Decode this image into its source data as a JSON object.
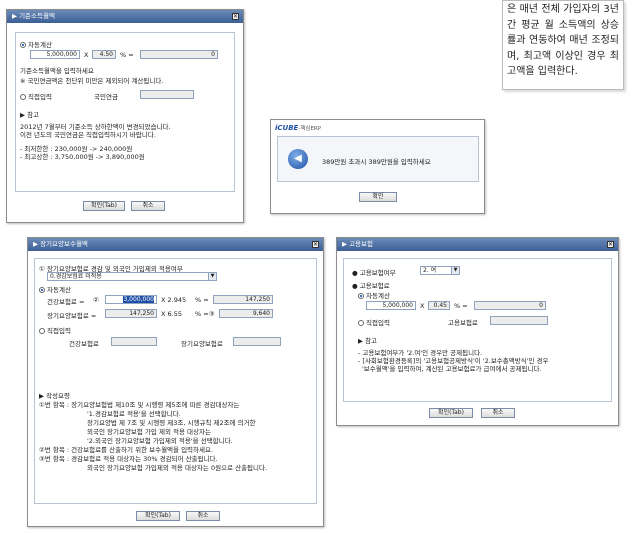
{
  "note": {
    "text": "은 매년 전체 가입자의 3년간 평균 월 소득액의 상승률과 연동하여 매년 조정되며, 최고액 이상인 경우 최고액을 입력한다."
  },
  "d1": {
    "title": "▶ 기준소득월액",
    "auto": "자동계산",
    "amount": "5,000,000",
    "x": "X",
    "rate": "4.50",
    "pct": "% =",
    "result": "0",
    "hint1": "기준소득월액을 입력하세요",
    "hint2": "※ 국민연금액은 천단위 미만은 제외되어 계산됩니다.",
    "manual": "직접입력",
    "pension_label": "국민연금",
    "ref": "▶ 참고",
    "ref1": "2012년 7월부터 기준소득 상하한액이 변경되었습니다.",
    "ref2": "이전 년도의 국민연금은 직접입력하시기 바랍니다.",
    "min": "- 최저한한 : 230,000원 -> 240,000원",
    "max": "- 최고상한 : 3,750,000원 -> 3,890,000원",
    "ok": "확인(Tab)",
    "cancel": "취소"
  },
  "d2": {
    "title_brand": "iCUBE",
    "title_rest": "-핵심ERP",
    "message": "389만원 초과시 389만원을 입력하세요",
    "ok": "확인"
  },
  "d3": {
    "title": "▶ 장기요양보수월액",
    "q": "① 장기요양보험료 경감 및 외국인 가입제외 적용여부",
    "select": "0.경감보험료 미적용",
    "auto": "자동계산",
    "health_label": "건강보험료 =",
    "circle2": "②",
    "health_value": "3,000,000",
    "x1": "X 2.945",
    "pct1": "% =",
    "r1": "147,250",
    "lt_label": "장기요양보험료 =",
    "lt_value": "147,250",
    "x2": "X 6.55",
    "pct2": "% =③",
    "r2": "9,640",
    "manual": "직접입력",
    "m_health": "건강보험료",
    "m_lt": "장기요양보험료",
    "guide": "▶ 작성요령",
    "g1": "①번 항목 : 장기요양보험법 제10조 및 시행령 제5조에 따른 경감대상자는",
    "g2": "'1.경감보험료 적용'을 선택합니다.",
    "g3": "장기요양법 제 7조 및 시행령 제3조, 시행규칙 제2조에 의거한",
    "g4": "외국인 장기요양보험 가입 제외 적용 대상자는",
    "g5": "'2.외국인 장기요양보험 가입제외 적용'을 선택합니다.",
    "g6": "②번 항목 : 건강보험료를 산출하기 위한 보수월액을 입력하세요.",
    "g7": "③번 항목 : 경감보험료 적용 대상자는 30% 경감되어 산출됩니다.",
    "g8": "외국인 장기요양보험 가입제외 적용 대상자는 0원으로 산출됩니다.",
    "ok": "확인(Tab)",
    "cancel": "취소"
  },
  "d4": {
    "title": "▶ 고용보험",
    "yn_label": "고용보험여부",
    "yn_value": "2. 여",
    "premium": "고용보험료",
    "auto": "자동계산",
    "amount": "5,000,000",
    "x": "X",
    "rate": "0.45",
    "pct": "% =",
    "result": "0",
    "manual": "직접입력",
    "m_label": "고용보험료",
    "ref": "▶ 참고",
    "r1": "- 고용보험여부가 '2.여'인 경우만 공제됩니다.",
    "r2": "- [사회보험환경등록]의 '고용보험공제방식'이 '2.보수총액방식'인 경우",
    "r3": "'보수월액'을 입력하여, 계산된 고용보험료가 급여에서 공제됩니다.",
    "ok": "확인(Tab)",
    "cancel": "취소"
  }
}
